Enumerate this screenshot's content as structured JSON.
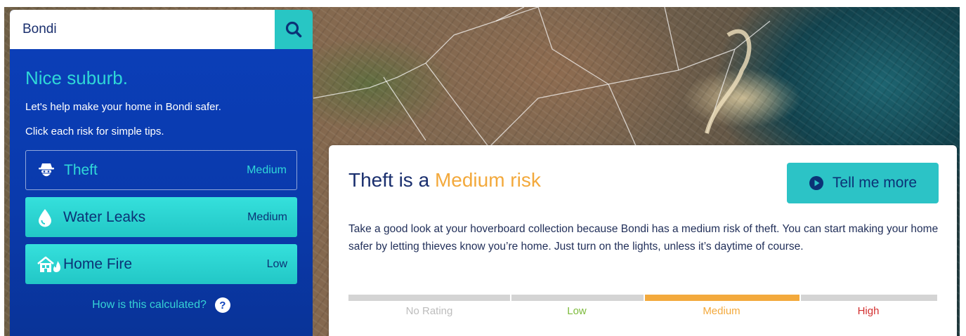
{
  "search": {
    "value": "Bondi"
  },
  "panel": {
    "headline": "Nice suburb.",
    "line1": "Let's help make your home in Bondi safer.",
    "line2": "Click each risk for simple tips.",
    "risks": [
      {
        "name": "Theft",
        "level": "Medium",
        "icon": "burglar-icon",
        "selected": true
      },
      {
        "name": "Water Leaks",
        "level": "Medium",
        "icon": "water-drop-icon",
        "selected": false
      },
      {
        "name": "Home Fire",
        "level": "Low",
        "icon": "house-fire-icon",
        "selected": false
      }
    ],
    "calc_link": "How is this calculated?",
    "help_glyph": "?"
  },
  "card": {
    "title_prefix": "Theft is a ",
    "title_accent": "Medium risk",
    "button_label": "Tell me more",
    "body": "Take a good look at your hoverboard collection because Bondi has a medium risk of theft. You can start making your home safer by letting thieves know you’re home. Just turn on the lights, unless it’s daytime of course.",
    "rating_scale": [
      {
        "label": "No Rating",
        "color": "#bdbdbd"
      },
      {
        "label": "Low",
        "color": "#7dbb3c"
      },
      {
        "label": "Medium",
        "color": "#f3a93c"
      },
      {
        "label": "High",
        "color": "#d32f2f"
      }
    ],
    "current_rating": "Medium"
  },
  "colors": {
    "panel_blue": "#0b3fba",
    "teal": "#2cc3c6",
    "accent_orange": "#f3a93c",
    "navy_text": "#1a2f6e"
  }
}
